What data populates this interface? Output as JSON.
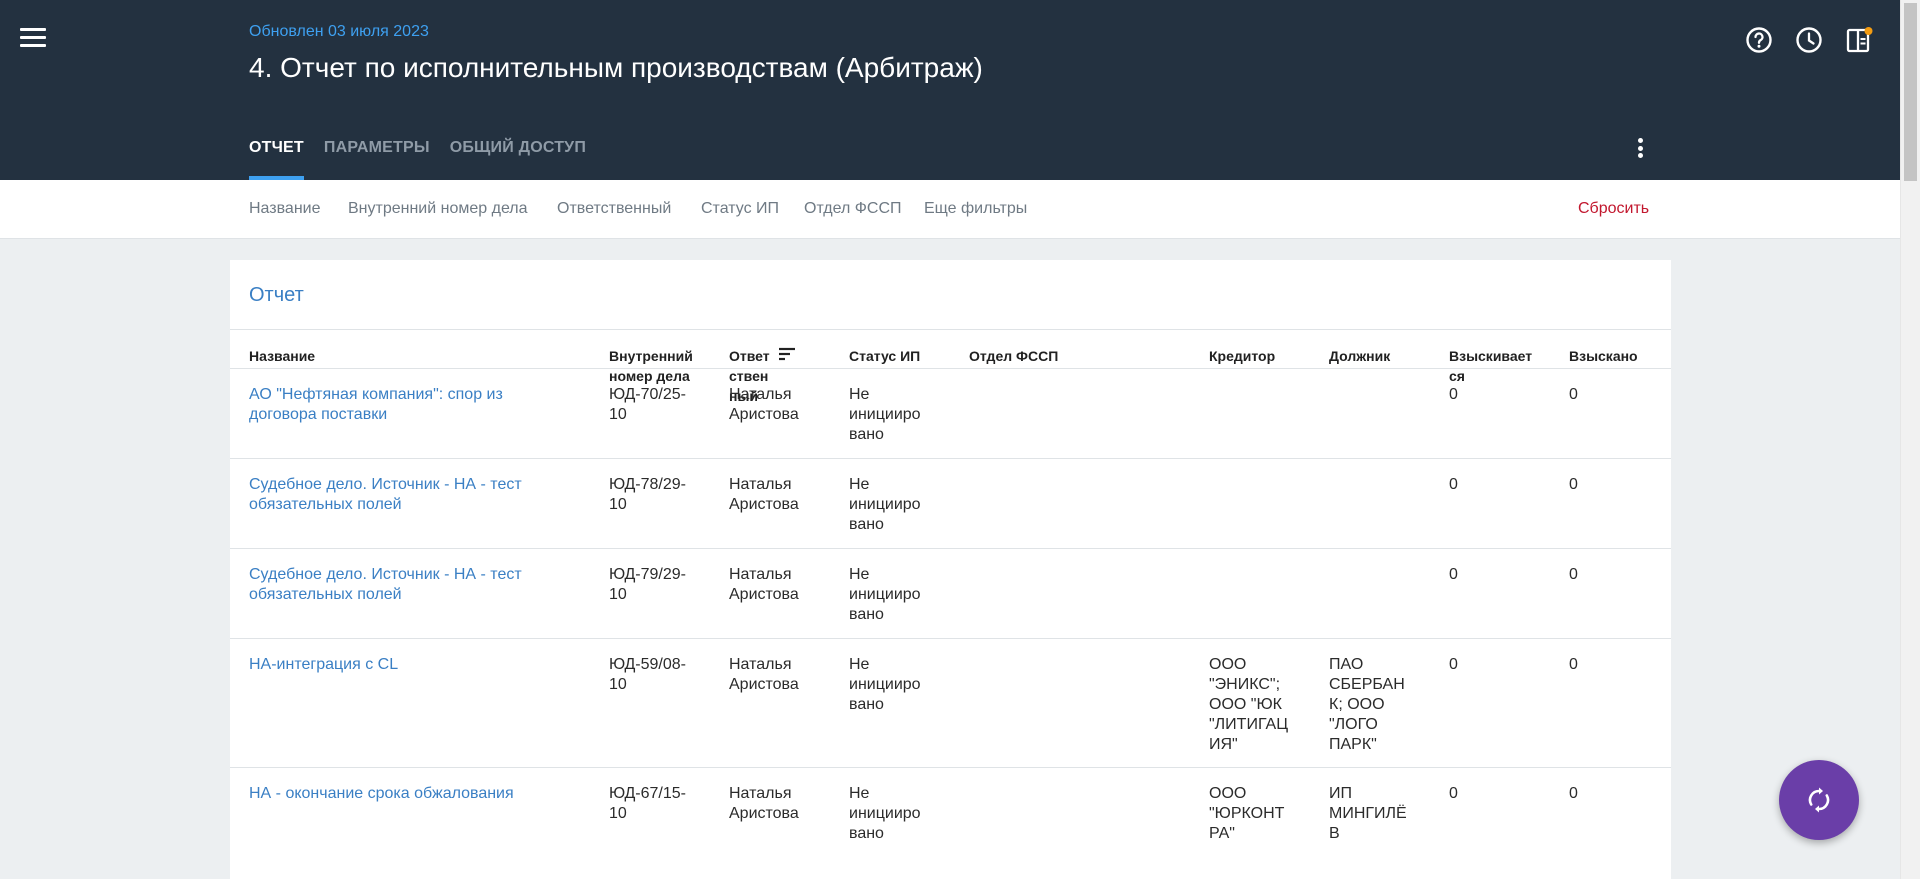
{
  "header": {
    "updated": "Обновлен 03 июля 2023",
    "title": "4. Отчет по исполнительным производствам (Арбитраж)",
    "tabs": [
      {
        "label": "ОТЧЕТ",
        "active": true
      },
      {
        "label": "ПАРАМЕТРЫ",
        "active": false
      },
      {
        "label": "ОБЩИЙ ДОСТУП",
        "active": false
      }
    ],
    "icons": [
      "help-icon",
      "history-icon",
      "panel-icon"
    ]
  },
  "filters": {
    "items": [
      "Название",
      "Внутренний номер дела",
      "Ответственный",
      "Статус ИП",
      "Отдел ФССП",
      "Еще фильтры"
    ],
    "reset": "Сбросить"
  },
  "report": {
    "title": "Отчет",
    "columns": [
      [
        "Название"
      ],
      [
        "Внутренний",
        "номер дела"
      ],
      [
        "Ответ",
        "ствен",
        "ный"
      ],
      [
        "Статус ИП"
      ],
      [
        "Отдел ФССП"
      ],
      [
        "Кредитор"
      ],
      [
        "Должник"
      ],
      [
        "Взыскивает",
        "ся"
      ],
      [
        "Взыскано"
      ]
    ],
    "rows": [
      {
        "name": [
          "АО \"Нефтяная компания\": спор из",
          "договора поставки"
        ],
        "num": [
          "ЮД-70/25-",
          "10"
        ],
        "resp": [
          "Наталья",
          "Аристова"
        ],
        "status": [
          "Не",
          "инициирo",
          "вано"
        ],
        "dept": [],
        "creditor": [],
        "debtor": [],
        "to_collect": [
          "0"
        ],
        "collected": [
          "0"
        ]
      },
      {
        "name": [
          "Судебное дело. Источник - НА - тест",
          "обязательных полей"
        ],
        "num": [
          "ЮД-78/29-",
          "10"
        ],
        "resp": [
          "Наталья",
          "Аристова"
        ],
        "status": [
          "Не",
          "инициирo",
          "вано"
        ],
        "dept": [],
        "creditor": [],
        "debtor": [],
        "to_collect": [
          "0"
        ],
        "collected": [
          "0"
        ]
      },
      {
        "name": [
          "Судебное дело. Источник - НА - тест",
          "обязательных полей"
        ],
        "num": [
          "ЮД-79/29-",
          "10"
        ],
        "resp": [
          "Наталья",
          "Аристова"
        ],
        "status": [
          "Не",
          "инициирo",
          "вано"
        ],
        "dept": [],
        "creditor": [],
        "debtor": [],
        "to_collect": [
          "0"
        ],
        "collected": [
          "0"
        ]
      },
      {
        "name": [
          "НА-интеграция с CL"
        ],
        "num": [
          "ЮД-59/08-",
          "10"
        ],
        "resp": [
          "Наталья",
          "Аристова"
        ],
        "status": [
          "Не",
          "инициирo",
          "вано"
        ],
        "dept": [],
        "creditor": [
          "ООО",
          "\"ЭНИКС\";",
          "ООО \"ЮК",
          "\"ЛИТИГАЦ",
          "ИЯ\""
        ],
        "debtor": [
          "ПАО",
          "СБЕРБАН",
          "К; ООО",
          "\"ЛОГО",
          "ПАРК\""
        ],
        "to_collect": [
          "0"
        ],
        "collected": [
          "0"
        ]
      },
      {
        "name": [
          "НА - окончание срока обжалования"
        ],
        "num": [
          "ЮД-67/15-",
          "10"
        ],
        "resp": [
          "Наталья",
          "Аристова"
        ],
        "status": [
          "Не",
          "инициирo",
          "вано"
        ],
        "dept": [],
        "creditor": [
          "ООО",
          "\"ЮРКОНТ",
          "РА\""
        ],
        "debtor": [
          "ИП",
          "МИНГИЛЁ",
          "В"
        ],
        "to_collect": [
          "0"
        ],
        "collected": [
          "0"
        ]
      }
    ]
  },
  "fab": {
    "icon": "sync-icon"
  }
}
